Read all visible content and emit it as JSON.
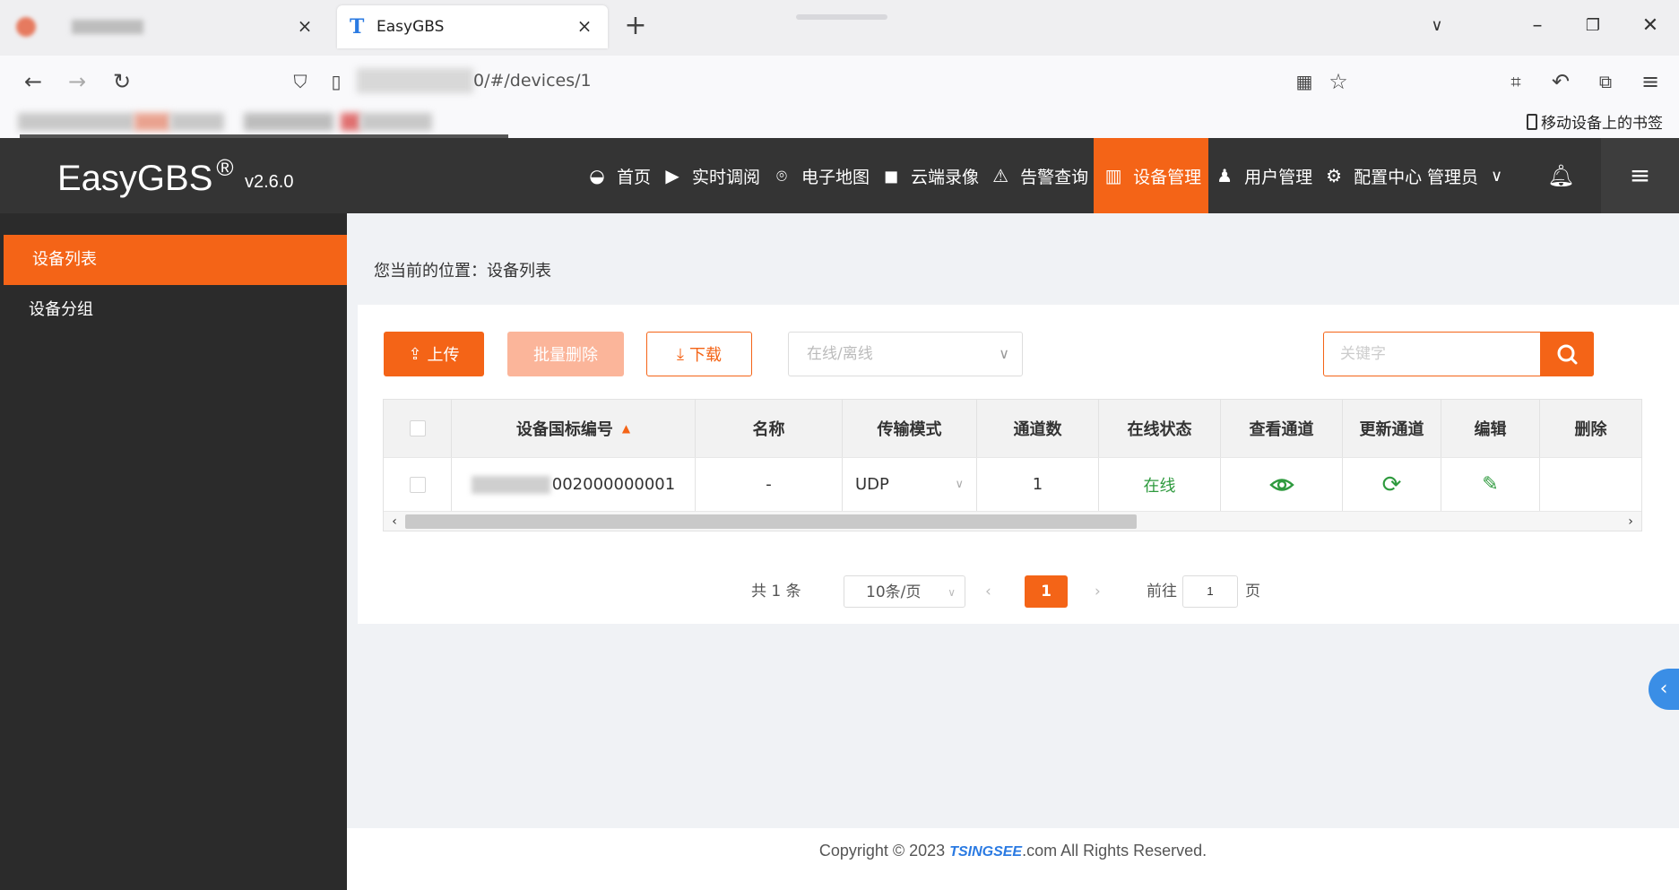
{
  "browser": {
    "tabs": [
      {
        "title": "",
        "close": "×"
      },
      {
        "title": "EasyGBS",
        "close": "×"
      }
    ],
    "new_tab": "+",
    "url": "0/#/devices/1",
    "mobile_bookmarks": "移动设备上的书签"
  },
  "app": {
    "logo": "EasyGBS",
    "logo_mark": "®",
    "version": "v2.6.0",
    "menu": [
      {
        "label": "首页",
        "icon": "dashboard-icon"
      },
      {
        "label": "实时调阅",
        "icon": "play-icon"
      },
      {
        "label": "电子地图",
        "icon": "map-pin-icon"
      },
      {
        "label": "云端录像",
        "icon": "video-camera-icon"
      },
      {
        "label": "告警查询",
        "icon": "alarm-icon"
      },
      {
        "label": "设备管理",
        "icon": "columns-icon",
        "active": true
      },
      {
        "label": "用户管理",
        "icon": "user-icon"
      },
      {
        "label": "配置中心",
        "icon": "gear-icon"
      }
    ],
    "user": "管理员"
  },
  "sidebar": {
    "items": [
      {
        "label": "设备列表",
        "active": true
      },
      {
        "label": "设备分组",
        "active": false
      }
    ]
  },
  "main": {
    "breadcrumb": "您当前的位置：设备列表",
    "toolbar": {
      "upload": "上传",
      "batch_delete": "批量删除",
      "download": "下载",
      "status_filter_placeholder": "在线/离线",
      "search_placeholder": "关键字"
    },
    "table": {
      "columns": [
        "设备国标编号",
        "名称",
        "传输模式",
        "通道数",
        "在线状态",
        "查看通道",
        "更新通道",
        "编辑",
        "删除"
      ],
      "rows": [
        {
          "id_suffix": "002000000001",
          "name": "-",
          "transport": "UDP",
          "channels": "1",
          "status": "在线"
        }
      ]
    },
    "pagination": {
      "total": "共 1 条",
      "page_size": "10条/页",
      "current_page": "1",
      "goto_label": "前往",
      "goto_value": "1",
      "page_unit": "页"
    },
    "footer": {
      "prefix": "Copyright © 2023",
      "brand": "TSINGSEE",
      "suffix": ".com All Rights Reserved."
    }
  },
  "colors": {
    "accent": "#f46417",
    "header_bg": "#343434",
    "sidebar_bg": "#2b2b2b",
    "online": "#2e9a3e"
  }
}
